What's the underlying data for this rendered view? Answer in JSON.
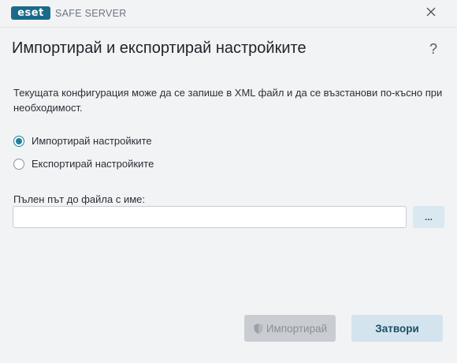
{
  "titlebar": {
    "logo_text": "eset",
    "product_name": "SAFE SERVER"
  },
  "dialog": {
    "title": "Импортирай и експортирай настройките",
    "help_symbol": "?",
    "description": "Текущата конфигурация може да се запише в XML файл и да се възстанови по-късно при необходимост.",
    "options": [
      {
        "label": "Импортирай настройките",
        "selected": true
      },
      {
        "label": "Експортирай настройките",
        "selected": false
      }
    ],
    "path_field": {
      "label": "Пълен път до файла с име:",
      "value": "",
      "browse_label": "..."
    },
    "buttons": {
      "import_label": "Импортирай",
      "import_enabled": false,
      "close_label": "Затвори"
    }
  },
  "colors": {
    "accent": "#1f7f9f",
    "logo_bg": "#1a6a8a",
    "background": "#f2f3f5"
  },
  "icons": [
    "close-icon",
    "help-icon",
    "shield-icon"
  ]
}
